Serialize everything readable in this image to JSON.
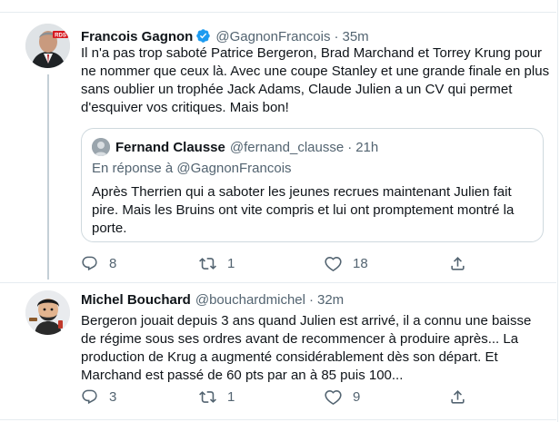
{
  "tweets": [
    {
      "display_name": "Francois Gagnon",
      "verified": true,
      "handle": "@GagnonFrancois",
      "time": "35m",
      "text": "Il n'a pas trop saboté Patrice Bergeron, Brad Marchand et Torrey Krung pour ne nommer que ceux là. Avec une coupe Stanley et une grande finale en plus sans oublier un trophée Jack Adams, Claude Julien a un CV qui permet d'esquiver vos critiques. Mais bon!",
      "avatar_badge": "RDS",
      "quote": {
        "display_name": "Fernand Clausse",
        "handle": "@fernand_clausse",
        "time": "21h",
        "reply_to": "En réponse à @GagnonFrancois",
        "text": "Après Therrien qui a saboter les jeunes recrues maintenant Julien fait pire. Mais les Bruins ont vite compris et lui ont promptement montré la porte."
      },
      "replies": "8",
      "retweets": "1",
      "likes": "18"
    },
    {
      "display_name": "Michel Bouchard",
      "handle": "@bouchardmichel",
      "time": "32m",
      "text": "Bergeron jouait depuis 3 ans quand Julien est arrivé, il a connu une baisse de régime sous ses ordres avant de recommencer à produire après... La production de Krug a augmenté considérablement dès son départ. Et Marchand est passé de 60 pts par an à 85 puis 100...",
      "replies": "3",
      "retweets": "1",
      "likes": "9"
    }
  ],
  "separator": "·",
  "colors": {
    "verified_blue": "#1d9bf0",
    "secondary_text": "#536471",
    "rds_red": "#d71920"
  }
}
